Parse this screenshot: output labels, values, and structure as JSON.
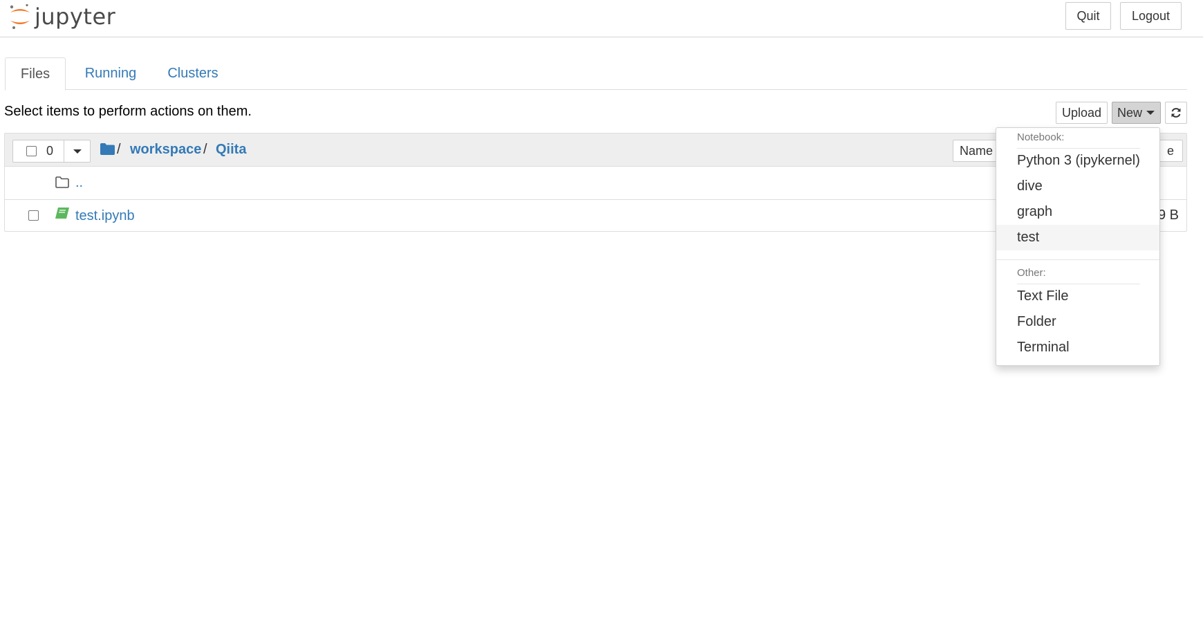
{
  "header": {
    "logo_text": "jupyter",
    "quit_label": "Quit",
    "logout_label": "Logout"
  },
  "tabs": [
    {
      "label": "Files",
      "active": true
    },
    {
      "label": "Running",
      "active": false
    },
    {
      "label": "Clusters",
      "active": false
    }
  ],
  "toolbar": {
    "hint": "Select items to perform actions on them.",
    "upload_label": "Upload",
    "new_label": "New",
    "refresh_icon": "refresh-icon"
  },
  "file_list": {
    "selected_count": "0",
    "breadcrumb": {
      "separator": "/",
      "items": [
        "workspace",
        "Qiita"
      ]
    },
    "sort_label": "Name",
    "parent_dir": "..",
    "files": [
      {
        "name": "test.ipynb",
        "size_partial": "9 B",
        "type": "notebook"
      }
    ],
    "hidden_column_partial": "e"
  },
  "new_menu": {
    "notebook_header": "Notebook:",
    "notebook_items": [
      "Python 3 (ipykernel)",
      "dive",
      "graph",
      "test"
    ],
    "highlighted": "test",
    "other_header": "Other:",
    "other_items": [
      "Text File",
      "Folder",
      "Terminal"
    ]
  },
  "colors": {
    "link": "#337ab7",
    "jupyter_orange": "#f37726",
    "notebook_green": "#5cb85c"
  }
}
